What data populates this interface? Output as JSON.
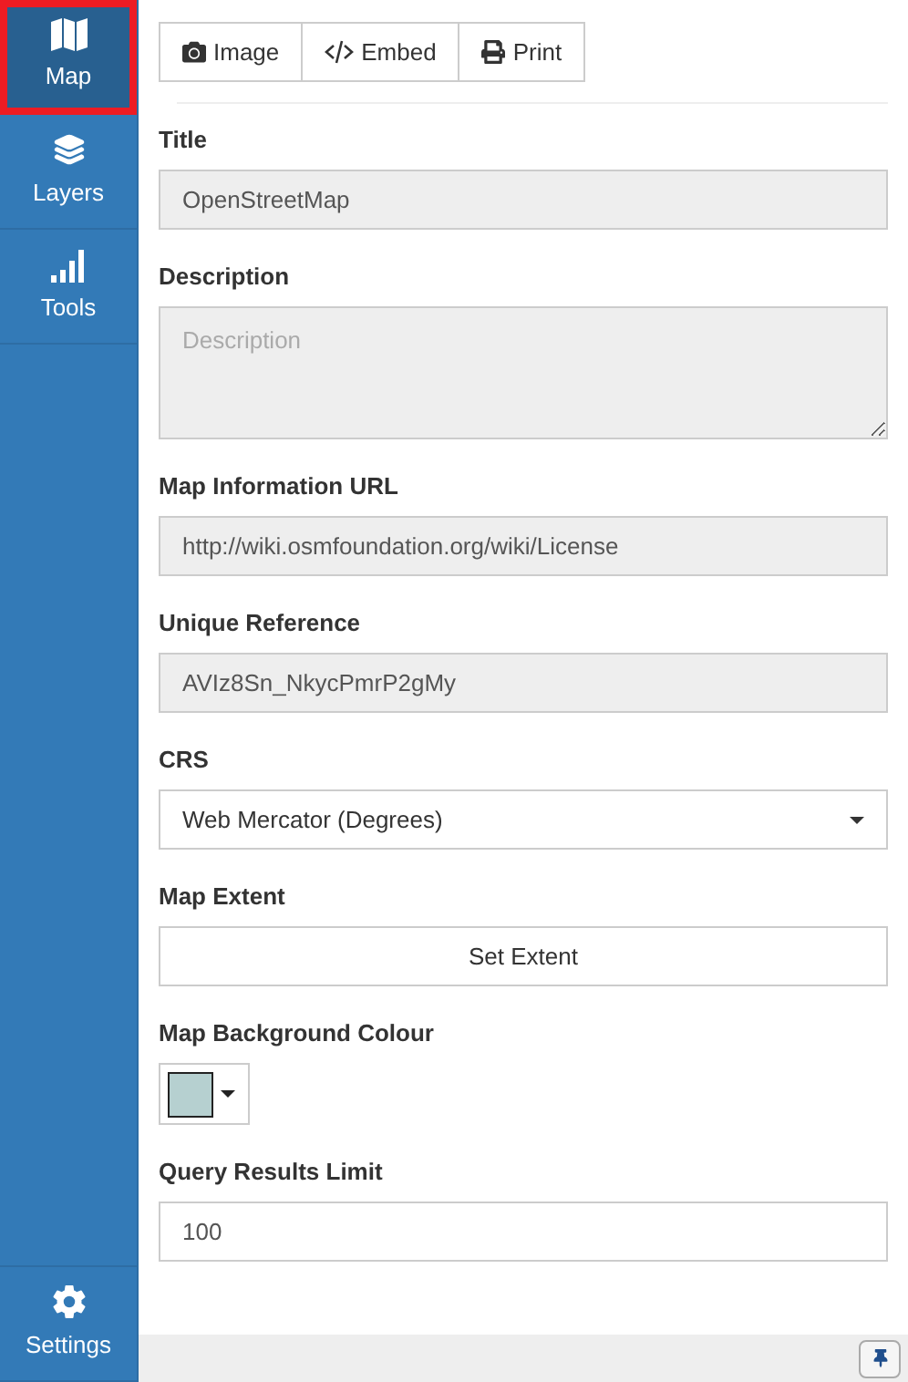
{
  "sidebar": {
    "items": [
      {
        "label": "Map",
        "kind": "map",
        "selected": true
      },
      {
        "label": "Layers",
        "kind": "layers",
        "selected": false
      },
      {
        "label": "Tools",
        "kind": "tools",
        "selected": false
      }
    ],
    "footer_item": {
      "label": "Settings",
      "kind": "settings",
      "selected": false
    }
  },
  "toolbar": [
    {
      "label": "Image",
      "kind": "camera"
    },
    {
      "label": "Embed",
      "kind": "code"
    },
    {
      "label": "Print",
      "kind": "print"
    }
  ],
  "fields": [
    {
      "kind": "readonly",
      "label": "Title",
      "value": "OpenStreetMap"
    },
    {
      "kind": "textarea",
      "label": "Description",
      "placeholder": "Description"
    },
    {
      "kind": "readonly",
      "label": "Map Information URL",
      "value": "http://wiki.osmfoundation.org/wiki/License"
    },
    {
      "kind": "readonly",
      "label": "Unique Reference",
      "value": "AVIz8Sn_NkycPmrP2gMy"
    },
    {
      "kind": "select",
      "label": "CRS",
      "value": "Web Mercator (Degrees)"
    },
    {
      "kind": "button",
      "label": "Map Extent",
      "value": "Set Extent"
    },
    {
      "kind": "color",
      "label": "Map Background Colour",
      "color": "#b6d0d0"
    },
    {
      "kind": "input",
      "label": "Query Results Limit",
      "value": "100"
    }
  ]
}
